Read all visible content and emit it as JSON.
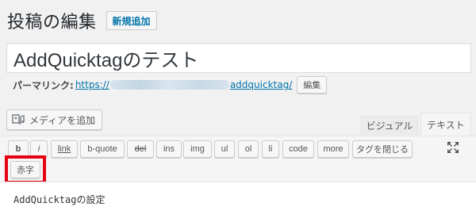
{
  "header": {
    "page_title": "投稿の編集",
    "add_new_label": "新規追加"
  },
  "post": {
    "title": "AddQuicktagのテスト",
    "content": "AddQuicktagの設定"
  },
  "permalink": {
    "label": "パーマリンク:",
    "url_prefix": "https://",
    "url_slug": "addquicktag/",
    "edit_label": "編集"
  },
  "media": {
    "add_label": "メディアを追加",
    "icon": "media-icon"
  },
  "editor_tabs": {
    "visual_label": "ビジュアル",
    "text_label": "テキスト"
  },
  "quicktags": {
    "b": "b",
    "i": "i",
    "link": "link",
    "bquote": "b-quote",
    "del": "del",
    "ins": "ins",
    "img": "img",
    "ul": "ul",
    "ol": "ol",
    "li": "li",
    "code": "code",
    "more": "more",
    "close_tags": "タグを閉じる",
    "custom_red": "赤字"
  },
  "colors": {
    "highlight": "#e60012",
    "link": "#0073aa"
  }
}
